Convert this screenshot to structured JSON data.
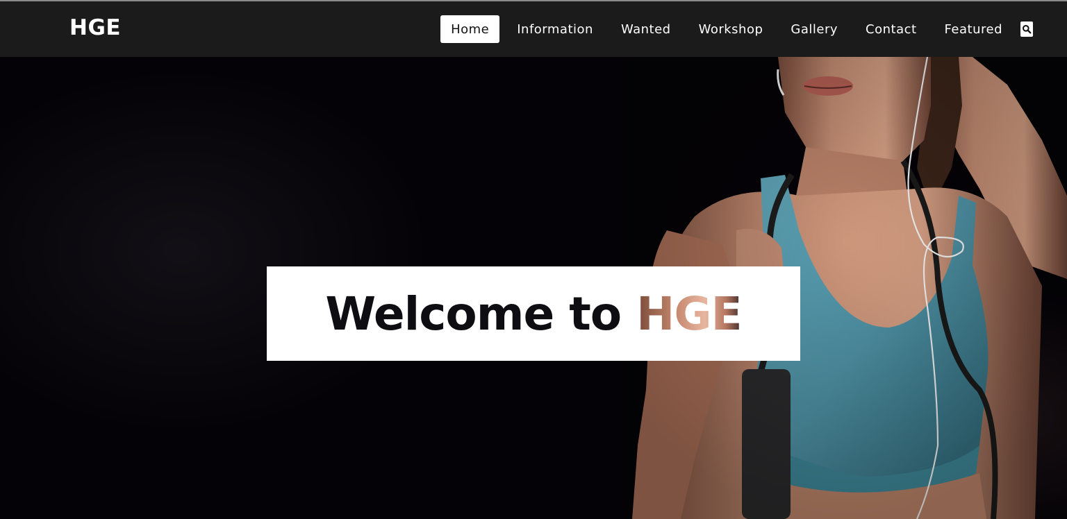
{
  "brand": "HGE",
  "nav": {
    "items": [
      {
        "label": "Home",
        "active": true
      },
      {
        "label": "Information",
        "active": false
      },
      {
        "label": "Wanted",
        "active": false
      },
      {
        "label": "Workshop",
        "active": false
      },
      {
        "label": "Gallery",
        "active": false
      },
      {
        "label": "Contact",
        "active": false
      },
      {
        "label": "Featured",
        "active": false
      }
    ],
    "search_icon": "search-icon"
  },
  "hero": {
    "welcome_prefix": "Welcome to ",
    "welcome_highlight": "HGE",
    "image": "woman-fitness-photo"
  },
  "colors": {
    "navbar_bg": "#1b1b1b",
    "hero_bg": "#040206",
    "top_bg": "#cd5c45",
    "skin": "#c08a72"
  }
}
